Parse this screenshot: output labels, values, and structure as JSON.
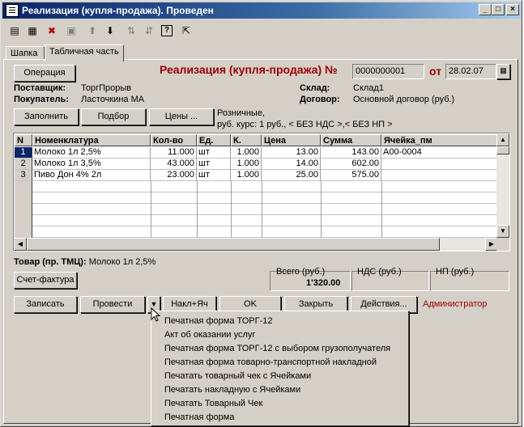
{
  "window": {
    "title": "Реализация (купля-продажа). Проведен",
    "minimize": "_",
    "maximize": "□",
    "close": "×"
  },
  "toolbar": {
    "icons": [
      "new-document-icon",
      "new-copy-icon",
      "delete-icon",
      "edit-icon",
      "move-up-icon",
      "move-down-icon",
      "sort-asc-icon",
      "sort-desc-icon",
      "help-icon",
      "context-help-icon"
    ]
  },
  "tabs": [
    {
      "label": "Шапка"
    },
    {
      "label": "Табличная часть"
    }
  ],
  "header": {
    "operation_button": "Операция",
    "doc_title": "Реализация (купля-продажа) №",
    "doc_number": "0000000001",
    "from_label": "от",
    "doc_date": "28.02.07",
    "supplier_label": "Поставщик:",
    "supplier_value": "ТоргПрорыв",
    "buyer_label": "Покупатель:",
    "buyer_value": "Ласточкина МА",
    "warehouse_label": "Склад:",
    "warehouse_value": "Склад1",
    "contract_label": "Договор:",
    "contract_value": "Основной договор (руб.)",
    "fill_button": "Заполнить",
    "select_button": "Подбор",
    "prices_button": "Цены ...",
    "price_info_line1": "Розничные,",
    "price_info_line2": "руб. курс: 1 руб., < БЕЗ НДС >,< БЕЗ НП >"
  },
  "table": {
    "columns": [
      "N",
      "Номенклатура",
      "Кол-во",
      "Ед.",
      "К.",
      "Цена",
      "Сумма",
      "Ячейка_пм"
    ],
    "rows": [
      {
        "n": "1",
        "name": "Молоко 1л 2,5%",
        "qty": "11.000",
        "unit": "шт",
        "k": "1.000",
        "price": "13.00",
        "sum": "143.00",
        "cell": "А00-0004"
      },
      {
        "n": "2",
        "name": "Молоко 1л 3,5%",
        "qty": "43.000",
        "unit": "шт",
        "k": "1.000",
        "price": "14.00",
        "sum": "602.00",
        "cell": ""
      },
      {
        "n": "3",
        "name": "Пиво Дон 4% 2л",
        "qty": "23.000",
        "unit": "шт",
        "k": "1.000",
        "price": "25.00",
        "sum": "575.00",
        "cell": ""
      }
    ]
  },
  "footer": {
    "goods_label": "Товар (пр. ТМЦ):",
    "goods_value": "Молоко 1л 2,5%",
    "invoice_button": "Счет-фактура",
    "total_label": "Всего (руб.)",
    "total_value": "1'320.00",
    "vat_label": "НДС (руб.)",
    "np_label": "НП (руб.)",
    "save_button": "Записать",
    "post_button": "Провести",
    "nakl_button": "Накл+Яч",
    "ok_button": "OK",
    "close_button": "Закрыть",
    "actions_button": "Действия...",
    "user": "Администратор"
  },
  "menu": {
    "items": [
      "Печатная форма ТОРГ-12",
      "Акт об оказании услуг",
      "Печатная форма ТОРГ-12 с выбором грузополучателя",
      "Печатная форма товарно-транспортной накладной",
      "Печатать товарный чек с Ячейками",
      "Печатать накладную с Ячейками",
      "Печатать Товарный Чек",
      "Печатная форма"
    ]
  }
}
